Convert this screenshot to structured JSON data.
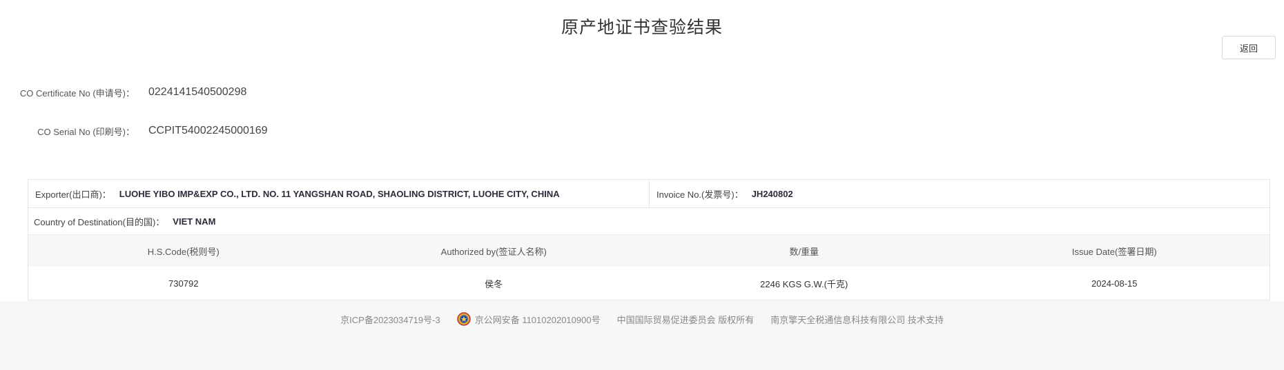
{
  "page": {
    "title": "原产地证书查验结果",
    "back_label": "返回"
  },
  "certificate": {
    "cert_no_label": "CO Certificate No (申请号)：",
    "cert_no_value": "0224141540500298",
    "serial_no_label": "CO Serial No (印刷号)：",
    "serial_no_value": "CCPIT54002245000169"
  },
  "details": {
    "exporter_label": "Exporter(出口商)：",
    "exporter_value": "LUOHE YIBO IMP&EXP CO., LTD. NO. 11 YANGSHAN ROAD, SHAOLING DISTRICT, LUOHE CITY, CHINA",
    "invoice_label": "Invoice No.(发票号)：",
    "invoice_value": "JH240802",
    "destination_label": "Country of Destination(目的国)：",
    "destination_value": "VIET NAM"
  },
  "table": {
    "headers": [
      "H.S.Code(税则号)",
      "Authorized by(签证人名称)",
      "数/重量",
      "Issue Date(签署日期)"
    ],
    "rows": [
      [
        "730792",
        "侯冬",
        "2246 KGS G.W.(千克)",
        "2024-08-15"
      ]
    ]
  },
  "footer": {
    "icp": "京ICP备2023034719号-3",
    "police": "京公网安备 11010202010900号",
    "copyright": "中国国际贸易促进委员会 版权所有",
    "support": "南京擎天全税通信息科技有限公司 技术支持",
    "police_icon": "police-badge-icon"
  },
  "colors": {
    "footer_bg": "#f7f7f7",
    "table_head_bg": "#f7f7f7",
    "border": "#e6e6e6"
  }
}
